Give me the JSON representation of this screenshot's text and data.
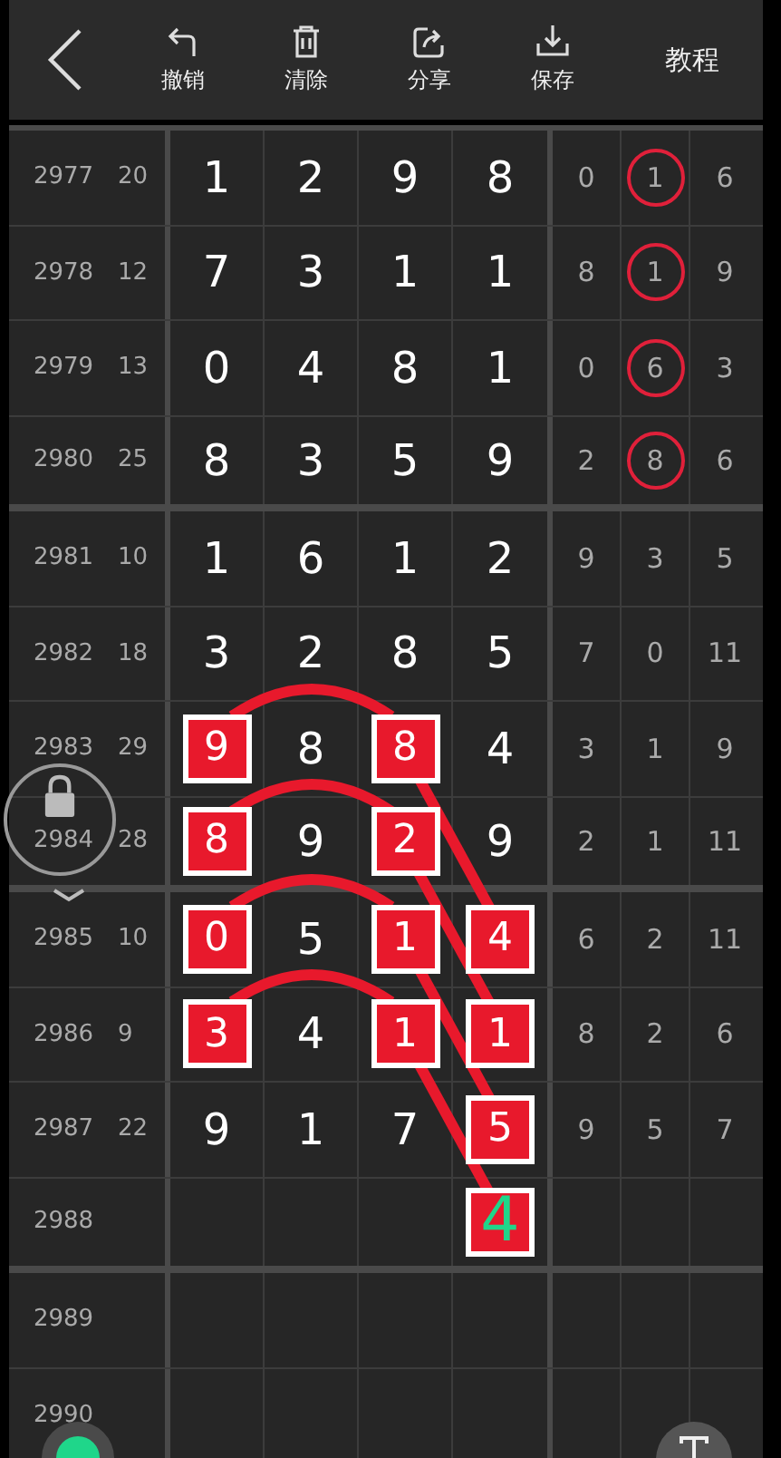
{
  "toolbar": {
    "buttons": [
      {
        "label": "撤销",
        "kind": "undo"
      },
      {
        "label": "清除",
        "kind": "clear"
      },
      {
        "label": "分享",
        "kind": "share"
      },
      {
        "label": "保存",
        "kind": "save"
      }
    ],
    "tutorial": "教程"
  },
  "rows": [
    {
      "issue": "2977",
      "sum": "20",
      "digits": [
        {
          "value": "1",
          "marked": false
        },
        {
          "value": "2",
          "marked": false
        },
        {
          "value": "9",
          "marked": false
        },
        {
          "value": "8",
          "marked": false
        }
      ],
      "stats": [
        {
          "value": "0",
          "circled": false
        },
        {
          "value": "1",
          "circled": true
        },
        {
          "value": "6",
          "circled": false
        }
      ]
    },
    {
      "issue": "2978",
      "sum": "12",
      "digits": [
        {
          "value": "7",
          "marked": false
        },
        {
          "value": "3",
          "marked": false
        },
        {
          "value": "1",
          "marked": false
        },
        {
          "value": "1",
          "marked": false
        }
      ],
      "stats": [
        {
          "value": "8",
          "circled": false
        },
        {
          "value": "1",
          "circled": true
        },
        {
          "value": "9",
          "circled": false
        }
      ]
    },
    {
      "issue": "2979",
      "sum": "13",
      "digits": [
        {
          "value": "0",
          "marked": false
        },
        {
          "value": "4",
          "marked": false
        },
        {
          "value": "8",
          "marked": false
        },
        {
          "value": "1",
          "marked": false
        }
      ],
      "stats": [
        {
          "value": "0",
          "circled": false
        },
        {
          "value": "6",
          "circled": true
        },
        {
          "value": "3",
          "circled": false
        }
      ]
    },
    {
      "issue": "2980",
      "sum": "25",
      "digits": [
        {
          "value": "8",
          "marked": false
        },
        {
          "value": "3",
          "marked": false
        },
        {
          "value": "5",
          "marked": false
        },
        {
          "value": "9",
          "marked": false
        }
      ],
      "stats": [
        {
          "value": "2",
          "circled": false
        },
        {
          "value": "8",
          "circled": true
        },
        {
          "value": "6",
          "circled": false
        }
      ]
    },
    {
      "issue": "2981",
      "sum": "10",
      "digits": [
        {
          "value": "1",
          "marked": false
        },
        {
          "value": "6",
          "marked": false
        },
        {
          "value": "1",
          "marked": false
        },
        {
          "value": "2",
          "marked": false
        }
      ],
      "stats": [
        {
          "value": "9",
          "circled": false
        },
        {
          "value": "3",
          "circled": false
        },
        {
          "value": "5",
          "circled": false
        }
      ]
    },
    {
      "issue": "2982",
      "sum": "18",
      "digits": [
        {
          "value": "3",
          "marked": false
        },
        {
          "value": "2",
          "marked": false
        },
        {
          "value": "8",
          "marked": false
        },
        {
          "value": "5",
          "marked": false
        }
      ],
      "stats": [
        {
          "value": "7",
          "circled": false
        },
        {
          "value": "0",
          "circled": false
        },
        {
          "value": "11",
          "circled": false
        }
      ]
    },
    {
      "issue": "2983",
      "sum": "29",
      "digits": [
        {
          "value": "9",
          "marked": true
        },
        {
          "value": "8",
          "marked": false
        },
        {
          "value": "8",
          "marked": true
        },
        {
          "value": "4",
          "marked": false
        }
      ],
      "stats": [
        {
          "value": "3",
          "circled": false
        },
        {
          "value": "1",
          "circled": false
        },
        {
          "value": "9",
          "circled": false
        }
      ]
    },
    {
      "issue": "2984",
      "sum": "28",
      "digits": [
        {
          "value": "8",
          "marked": true
        },
        {
          "value": "9",
          "marked": false
        },
        {
          "value": "2",
          "marked": true
        },
        {
          "value": "9",
          "marked": false
        }
      ],
      "stats": [
        {
          "value": "2",
          "circled": false
        },
        {
          "value": "1",
          "circled": false
        },
        {
          "value": "11",
          "circled": false
        }
      ]
    },
    {
      "issue": "2985",
      "sum": "10",
      "digits": [
        {
          "value": "0",
          "marked": true
        },
        {
          "value": "5",
          "marked": false
        },
        {
          "value": "1",
          "marked": true
        },
        {
          "value": "4",
          "marked": true
        }
      ],
      "stats": [
        {
          "value": "6",
          "circled": false
        },
        {
          "value": "2",
          "circled": false
        },
        {
          "value": "11",
          "circled": false
        }
      ]
    },
    {
      "issue": "2986",
      "sum": "9",
      "digits": [
        {
          "value": "3",
          "marked": true
        },
        {
          "value": "4",
          "marked": false
        },
        {
          "value": "1",
          "marked": true
        },
        {
          "value": "1",
          "marked": true
        }
      ],
      "stats": [
        {
          "value": "8",
          "circled": false
        },
        {
          "value": "2",
          "circled": false
        },
        {
          "value": "6",
          "circled": false
        }
      ]
    },
    {
      "issue": "2987",
      "sum": "22",
      "digits": [
        {
          "value": "9",
          "marked": false
        },
        {
          "value": "1",
          "marked": false
        },
        {
          "value": "7",
          "marked": false
        },
        {
          "value": "5",
          "marked": true
        }
      ],
      "stats": [
        {
          "value": "9",
          "circled": false
        },
        {
          "value": "5",
          "circled": false
        },
        {
          "value": "7",
          "circled": false
        }
      ]
    },
    {
      "issue": "2988",
      "forecast": {
        "value": "4"
      }
    },
    {
      "issue": "2989"
    },
    {
      "issue": "2990"
    }
  ]
}
